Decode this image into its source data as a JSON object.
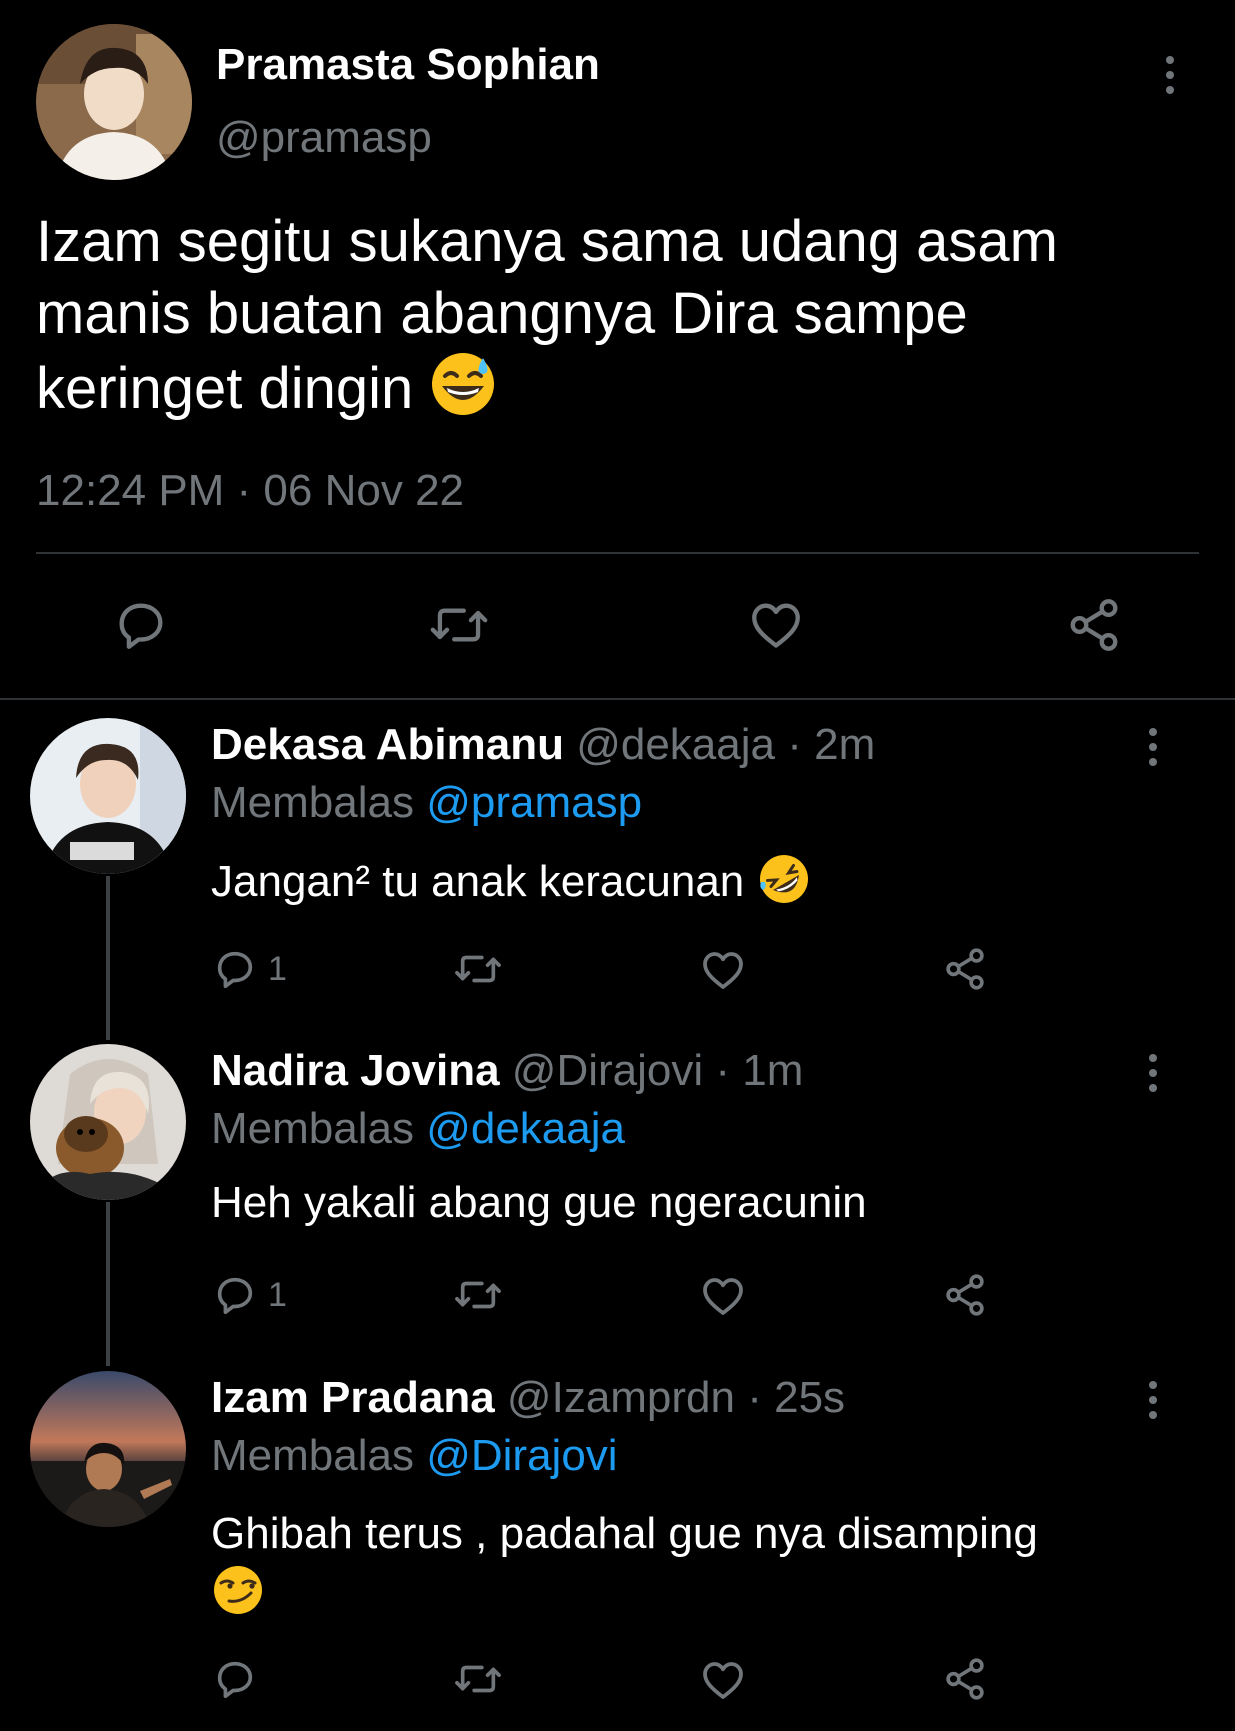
{
  "main_tweet": {
    "author_name": "Pramasta Sophian",
    "author_handle": "@pramasp",
    "text_line1": "Izam segitu sukanya sama udang asam",
    "text_line2": "manis buatan abangnya Dira sampe",
    "text_line3": "keringet dingin",
    "emoji": "downcast-face-with-sweat",
    "timestamp": "12:24 PM · 06 Nov 22"
  },
  "replies": [
    {
      "author_name": "Dekasa Abimanu",
      "author_handle": "@dekaaja",
      "time": "· 2m",
      "replying_prefix": "Membalas",
      "replying_to": "@pramasp",
      "text": "Jangan² tu anak keracunan",
      "emoji": "rolling-on-floor-laughing",
      "reply_count": "1"
    },
    {
      "author_name": "Nadira Jovina",
      "author_handle": "@Dirajovi",
      "time": "· 1m",
      "replying_prefix": "Membalas",
      "replying_to": "@dekaaja",
      "text": "Heh yakali abang gue ngeracunin",
      "reply_count": "1"
    },
    {
      "author_name": "Izam Pradana",
      "author_handle": "@Izamprdn",
      "time": "· 25s",
      "replying_prefix": "Membalas",
      "replying_to": "@Dirajovi",
      "text": "Ghibah terus , padahal gue nya disamping",
      "emoji": "smirking-face",
      "reply_count": ""
    }
  ],
  "colors": {
    "background": "#000000",
    "text": "#ffffff",
    "secondary": "#71767b",
    "link": "#1d9bf0",
    "divider": "#2f3336"
  }
}
